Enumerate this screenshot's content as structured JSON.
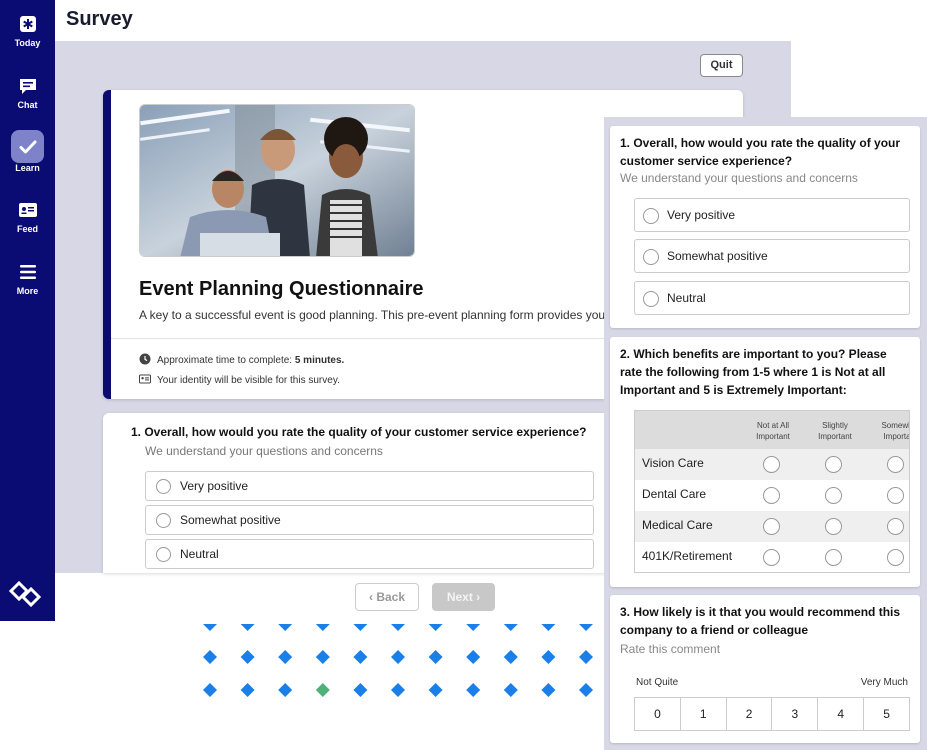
{
  "app": {
    "page_title": "Survey",
    "quit_label": "Quit"
  },
  "sidebar": {
    "items": [
      {
        "label": "Today",
        "icon": "asterisk-icon"
      },
      {
        "label": "Chat",
        "icon": "chat-bubble-icon"
      },
      {
        "label": "Learn",
        "icon": "checkmark-icon",
        "active": true
      },
      {
        "label": "Feed",
        "icon": "id-card-icon"
      },
      {
        "label": "More",
        "icon": "hamburger-icon"
      }
    ],
    "bg_color": "#0b0b74"
  },
  "intro": {
    "title": "Event Planning Questionnaire",
    "description": "A key to a successful event is good planning. This pre-event planning form provides your",
    "time_prefix": "Approximate time to complete: ",
    "time_value": "5 minutes.",
    "identity_note": "Your identity will be visible for this survey."
  },
  "question1": {
    "title": "1. Overall, how would you rate the quality of your customer service experience?",
    "title_line1": "1. Overall, how would you rate the quality of your",
    "title_line2": "customer service experience?",
    "subtitle": "We understand your questions and concerns",
    "options": [
      "Very positive",
      "Somewhat positive",
      "Neutral"
    ]
  },
  "question2": {
    "title_line1": "2. Which benefits are important to you? Please",
    "title_line2": "rate the following from 1-5 where 1 is Not at all",
    "title_line3": "Important and 5 is Extremely Important:",
    "columns": [
      {
        "line1": "Not at All",
        "line2": "Important"
      },
      {
        "line1": "Slightly",
        "line2": "Important"
      },
      {
        "line1": "Somewh",
        "line2": "Importa"
      }
    ],
    "rows": [
      "Vision Care",
      "Dental Care",
      "Medical Care",
      "401K/Retirement"
    ]
  },
  "question3": {
    "title_line1": "3. How likely is it that you would recommend this",
    "title_line2": "company to a friend or colleague",
    "subtitle": "Rate this comment",
    "min_label": "Not Quite",
    "max_label": "Very Much",
    "scale": [
      "0",
      "1",
      "2",
      "3",
      "4",
      "5"
    ]
  },
  "navigation": {
    "back_label": "Back",
    "next_label": "Next"
  },
  "progress": {
    "total_pages": 33,
    "current_page": 26,
    "accent": "#1a7fe8",
    "current_color": "#4fb07a"
  }
}
